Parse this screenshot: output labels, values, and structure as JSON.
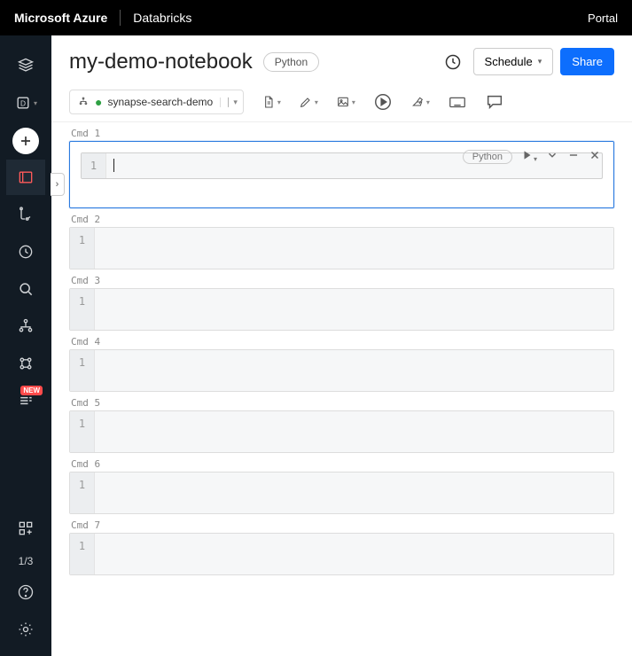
{
  "header": {
    "brand": "Microsoft Azure",
    "product": "Databricks",
    "portal": "Portal"
  },
  "sidebar": {
    "new_badge": "NEW",
    "counter": "1/3"
  },
  "notebook": {
    "title": "my-demo-notebook",
    "language_pill": "Python",
    "schedule_label": "Schedule",
    "share_label": "Share",
    "cluster_name": "synapse-search-demo"
  },
  "cells": [
    {
      "label": "Cmd 1",
      "line": "1",
      "active": true,
      "lang": "Python"
    },
    {
      "label": "Cmd 2",
      "line": "1",
      "active": false
    },
    {
      "label": "Cmd 3",
      "line": "1",
      "active": false
    },
    {
      "label": "Cmd 4",
      "line": "1",
      "active": false
    },
    {
      "label": "Cmd 5",
      "line": "1",
      "active": false
    },
    {
      "label": "Cmd 6",
      "line": "1",
      "active": false
    },
    {
      "label": "Cmd 7",
      "line": "1",
      "active": false
    }
  ]
}
